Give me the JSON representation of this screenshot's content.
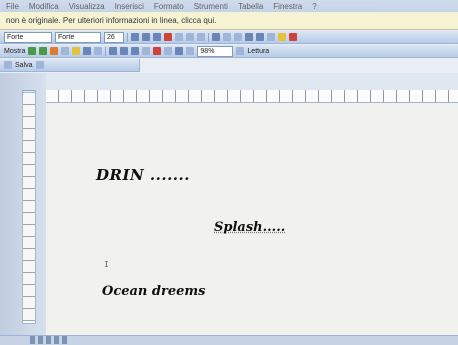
{
  "menu": {
    "items": [
      "File",
      "Modifica",
      "Visualizza",
      "Inserisci",
      "Formato",
      "Strumenti",
      "Tabella",
      "Finestra",
      "?"
    ]
  },
  "infobar": {
    "text": "non è originale. Per ulteriori informazioni in linea, clicca qui."
  },
  "formatting": {
    "style": "Forte",
    "font": "Forte",
    "size": "26"
  },
  "toolbar": {
    "mostra_label": "Mostra",
    "zoom": "98%",
    "lettura_label": "Lettura",
    "salva_label": "Salva"
  },
  "document": {
    "line1": "DRIN .......",
    "line2": "Splash.....",
    "line3": "Ocean dreems"
  }
}
